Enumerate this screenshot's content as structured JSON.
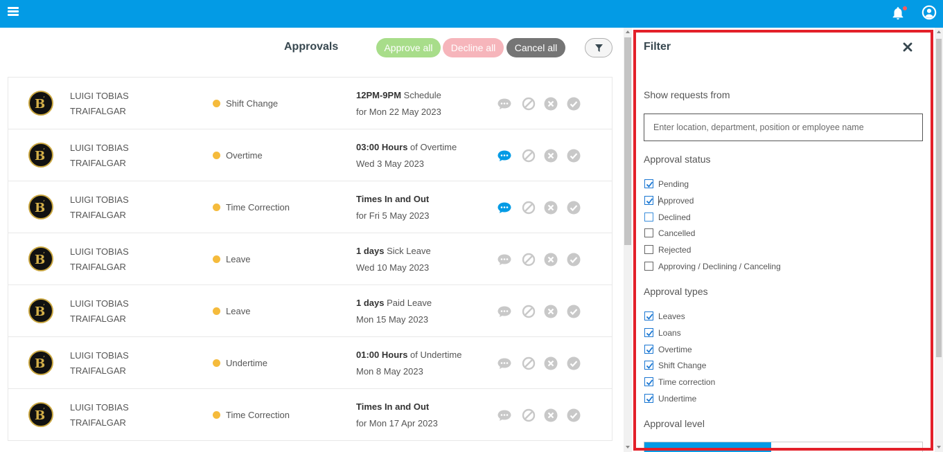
{
  "header": {
    "menu_icon": "hamburger-icon",
    "notifications_icon": "bell-icon",
    "account_icon": "user-circle-icon",
    "colors": {
      "bar": "#039be5",
      "badge": "#ff5a5a"
    }
  },
  "main": {
    "title": "Approvals",
    "approve_all_label": "Approve all",
    "decline_all_label": "Decline all",
    "cancel_all_label": "Cancel all",
    "filter_icon": "funnel-icon",
    "rows": [
      {
        "first_name": "LUIGI TOBIAS",
        "last_name": "TRAIFALGAR",
        "type": "Shift Change",
        "detail_bold": "12PM-9PM",
        "detail_rest": " Schedule",
        "date": "for Mon 22 May 2023",
        "has_comment": false
      },
      {
        "first_name": "LUIGI TOBIAS",
        "last_name": "TRAIFALGAR",
        "type": "Overtime",
        "detail_bold": "03:00 Hours",
        "detail_rest": " of Overtime",
        "date": "Wed 3 May 2023",
        "has_comment": true
      },
      {
        "first_name": "LUIGI TOBIAS",
        "last_name": "TRAIFALGAR",
        "type": "Time Correction",
        "detail_bold": "Times In and Out",
        "detail_rest": "",
        "date": "for Fri 5 May 2023",
        "has_comment": true
      },
      {
        "first_name": "LUIGI TOBIAS",
        "last_name": "TRAIFALGAR",
        "type": "Leave",
        "detail_bold": "1 days",
        "detail_rest": " Sick Leave",
        "date": "Wed 10 May 2023",
        "has_comment": false
      },
      {
        "first_name": "LUIGI TOBIAS",
        "last_name": "TRAIFALGAR",
        "type": "Leave",
        "detail_bold": "1 days",
        "detail_rest": " Paid Leave",
        "date": "Mon 15 May 2023",
        "has_comment": false
      },
      {
        "first_name": "LUIGI TOBIAS",
        "last_name": "TRAIFALGAR",
        "type": "Undertime",
        "detail_bold": "01:00 Hours",
        "detail_rest": " of Undertime",
        "date": "Mon 8 May 2023",
        "has_comment": false
      },
      {
        "first_name": "LUIGI TOBIAS",
        "last_name": "TRAIFALGAR",
        "type": "Time Correction",
        "detail_bold": "Times In and Out",
        "detail_rest": "",
        "date": "for Mon 17 Apr 2023",
        "has_comment": false
      }
    ],
    "colors": {
      "status_dot": "#f5bb3c",
      "comment_active": "#039be5",
      "action_inactive": "#c8c8c8"
    }
  },
  "filter": {
    "title": "Filter",
    "close_icon": "close-icon",
    "show_requests_label": "Show requests from",
    "search_placeholder": "Enter location, department, position or employee name",
    "status_label": "Approval status",
    "statuses": [
      {
        "label": "Pending",
        "checked": true
      },
      {
        "label": "Approved",
        "checked": true
      },
      {
        "label": "Declined",
        "checked": false
      },
      {
        "label": "Cancelled",
        "checked": false
      },
      {
        "label": "Rejected",
        "checked": false
      },
      {
        "label": "Approving / Declining / Canceling",
        "checked": false
      }
    ],
    "types_label": "Approval types",
    "types": [
      {
        "label": "Leaves",
        "checked": true
      },
      {
        "label": "Loans",
        "checked": true
      },
      {
        "label": "Overtime",
        "checked": true
      },
      {
        "label": "Shift Change",
        "checked": true
      },
      {
        "label": "Time correction",
        "checked": true
      },
      {
        "label": "Undertime",
        "checked": true
      }
    ],
    "level_label": "Approval level",
    "colors": {
      "highlight_frame": "#e3202a",
      "check": "#1976d2"
    }
  }
}
